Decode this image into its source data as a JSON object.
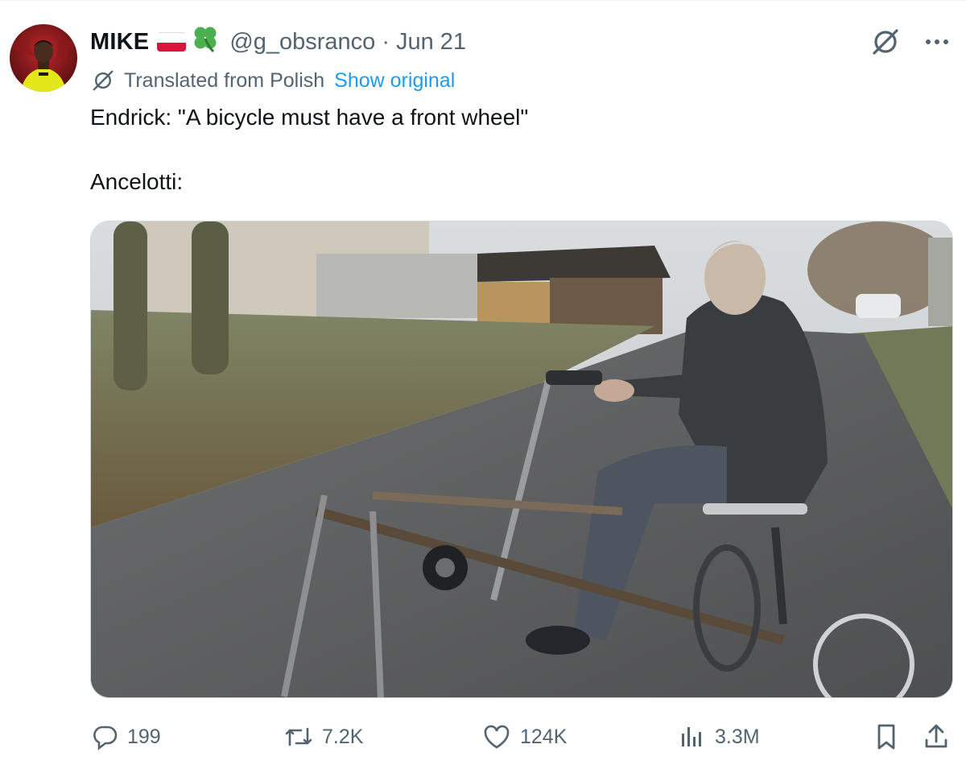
{
  "author": {
    "display_name": "MIKE",
    "handle": "@g_obsranco",
    "separator": "·",
    "date": "Jun 21",
    "avatar_icon": "avatar-player-yellow-kit",
    "flag_icon": "poland-flag-icon",
    "badge_icon": "four-leaf-clover-icon"
  },
  "header_actions": {
    "grok_icon": "grok-icon",
    "more_icon": "more-icon"
  },
  "translation": {
    "icon": "translate-icon",
    "label": "Translated from Polish",
    "show_original": "Show original"
  },
  "post": {
    "line1": "Endrick: \"A bicycle must have a front wheel\"",
    "line2": "Ancelotti:"
  },
  "media": {
    "description_icon": "embedded-video-frame"
  },
  "actions": {
    "replies": "199",
    "reposts": "7.2K",
    "likes": "124K",
    "views": "3.3M"
  },
  "colors": {
    "accent": "#1d9bf0",
    "muted": "#536471",
    "text": "#0f1419"
  }
}
